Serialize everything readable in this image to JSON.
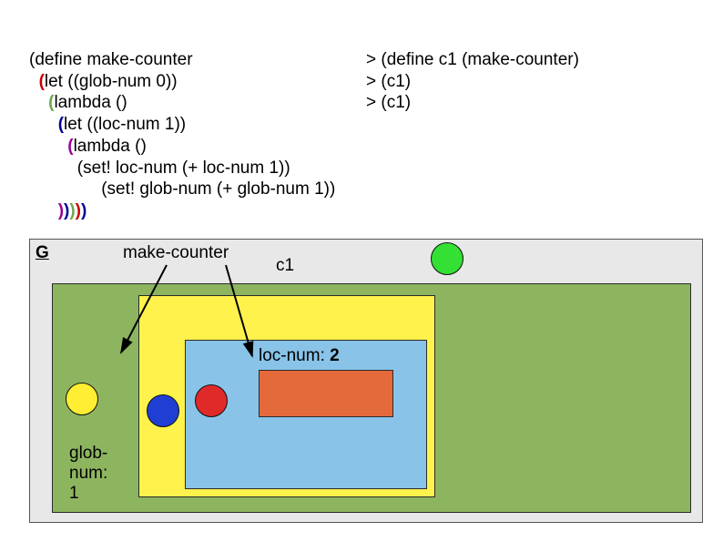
{
  "code": {
    "l1": "(define make-counter",
    "l2_open": "(",
    "l2_rest": "let ((glob-num 0))",
    "l3_open": "(",
    "l3_rest": "lambda ()",
    "l4_open": "(",
    "l4_rest": "let ((loc-num 1))",
    "l5_open": "(",
    "l5_rest": "lambda ()",
    "l6": "(set! loc-num (+ loc-num 1))",
    "l7": "(set! glob-num (+ glob-num 1))",
    "close_p5": ")",
    "close_p4": ")",
    "close_p3": ")",
    "close_p2": ")",
    "close_p1": ")"
  },
  "repl": {
    "l1": "> (define c1 (make-counter)",
    "l2": "> (c1)",
    "l3": "> (c1)"
  },
  "env": {
    "G": "G",
    "make_counter": "make-counter",
    "c1": "c1",
    "glob_num_label": "glob-\nnum:\n",
    "glob_num_value": "1",
    "loc_num_label": "loc-num: ",
    "loc_num_value": "2"
  }
}
